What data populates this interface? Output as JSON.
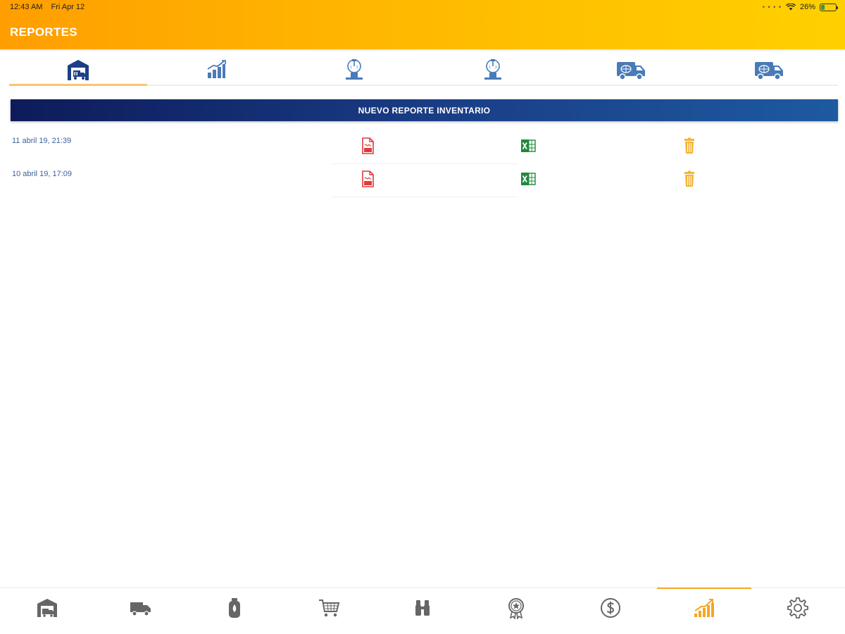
{
  "status_bar": {
    "time": "12:43 AM",
    "date": "Fri Apr 12",
    "battery": "26%",
    "battery_level": 0.26
  },
  "header": {
    "title": "REPORTES",
    "gradient": [
      "#ff9e00",
      "#ffd000"
    ]
  },
  "top_tabs": [
    {
      "icon": "warehouse-icon",
      "active": true
    },
    {
      "icon": "bar-chart-icon",
      "active": false
    },
    {
      "icon": "scale-icon",
      "active": false
    },
    {
      "icon": "scale-icon",
      "active": false
    },
    {
      "icon": "delivery-truck-icon",
      "active": false
    },
    {
      "icon": "delivery-truck-icon",
      "active": false
    }
  ],
  "new_report": {
    "label": "NUEVO REPORTE INVENTARIO"
  },
  "reports": [
    {
      "date": "11 abril 19, 21:39",
      "actions": [
        "pdf-icon",
        "excel-icon",
        "trash-icon"
      ]
    },
    {
      "date": "10 abril 19, 17:09",
      "actions": [
        "pdf-icon",
        "excel-icon",
        "trash-icon"
      ]
    }
  ],
  "bottom_nav": [
    {
      "icon": "warehouse-icon",
      "active": false
    },
    {
      "icon": "truck-icon",
      "active": false
    },
    {
      "icon": "gas-cylinder-icon",
      "active": false
    },
    {
      "icon": "shopping-cart-icon",
      "active": false
    },
    {
      "icon": "binoculars-icon",
      "active": false
    },
    {
      "icon": "award-badge-icon",
      "active": false
    },
    {
      "icon": "dollar-icon",
      "active": false
    },
    {
      "icon": "reports-chart-icon",
      "active": true
    },
    {
      "icon": "settings-gear-icon",
      "active": false
    }
  ],
  "colors": {
    "accent": "#f5a623",
    "brand_blue": "#1a3f88",
    "icon_blue": "#4a7ab8",
    "pdf_red": "#e03b3b",
    "excel_green": "#1e8a3c",
    "trash_orange": "#f3b43a",
    "nav_gray": "#666666"
  }
}
